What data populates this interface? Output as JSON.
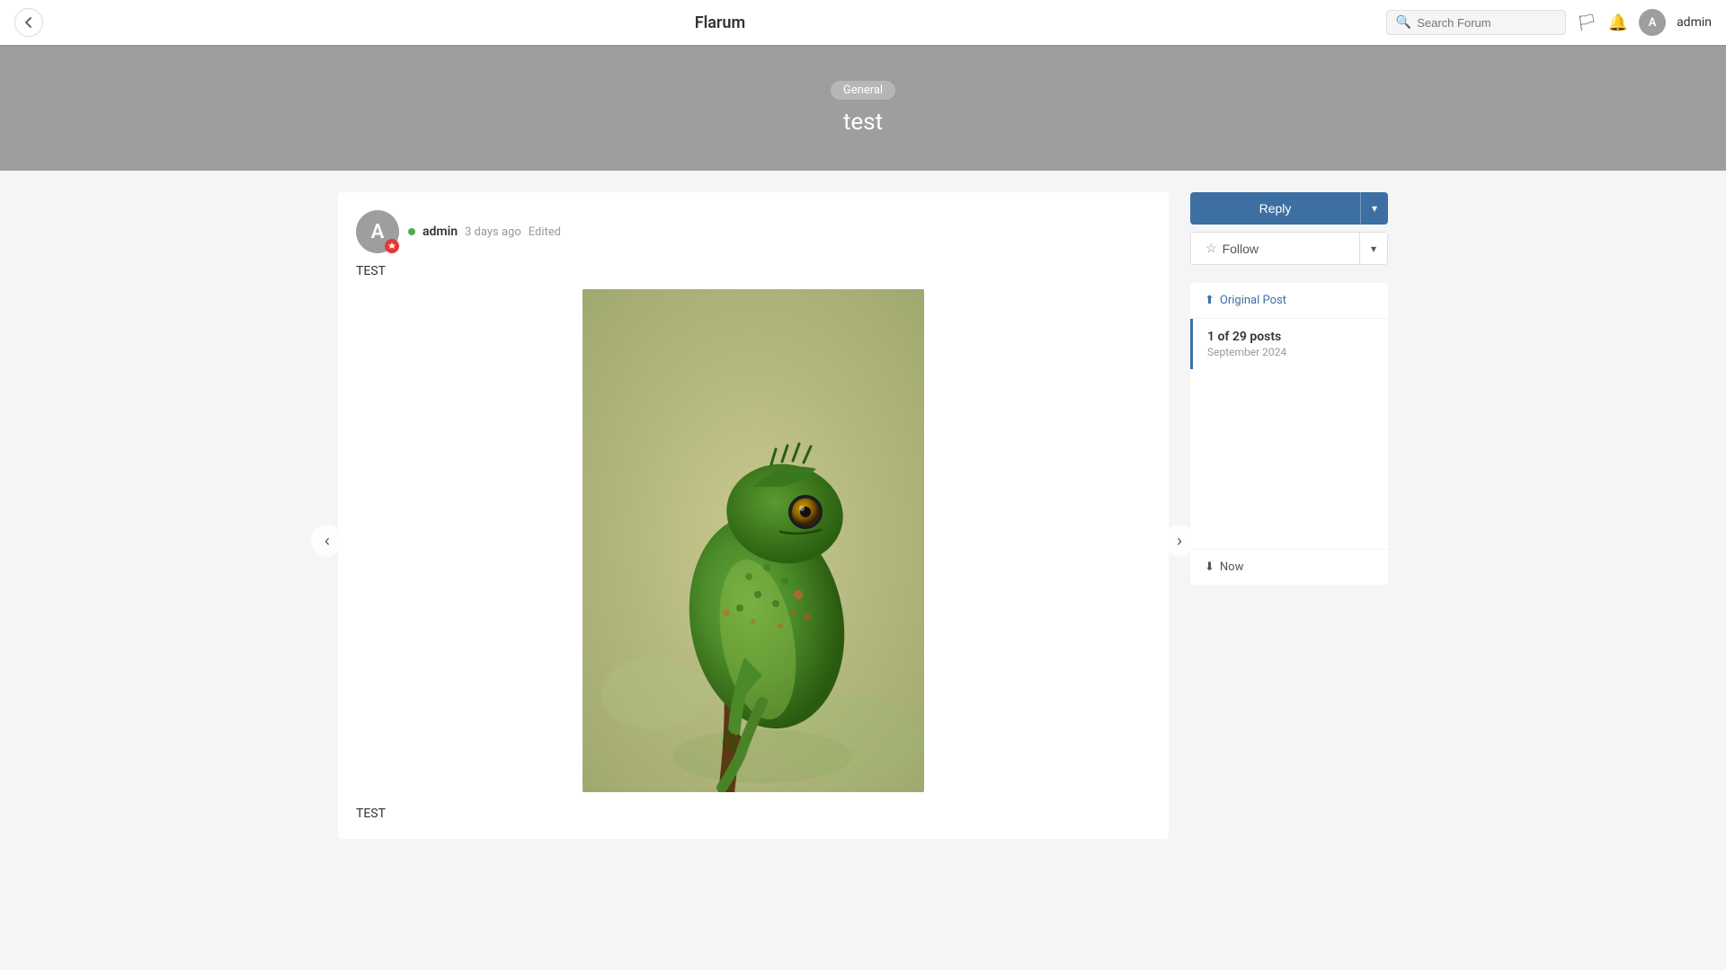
{
  "header": {
    "app_name": "Flarum",
    "search_placeholder": "Search Forum",
    "username": "admin"
  },
  "hero": {
    "category": "General",
    "post_title": "test"
  },
  "post": {
    "author": "admin",
    "time": "3 days ago",
    "edited": "Edited",
    "body_text": "TEST",
    "footer_text": "TEST",
    "image_alt": "Chameleon on a branch"
  },
  "sidebar": {
    "reply_label": "Reply",
    "dropdown_arrow": "▾",
    "follow_label": "Follow",
    "original_post_label": "Original Post",
    "post_count": "1 of 29 posts",
    "post_date": "September 2024",
    "now_label": "Now"
  }
}
